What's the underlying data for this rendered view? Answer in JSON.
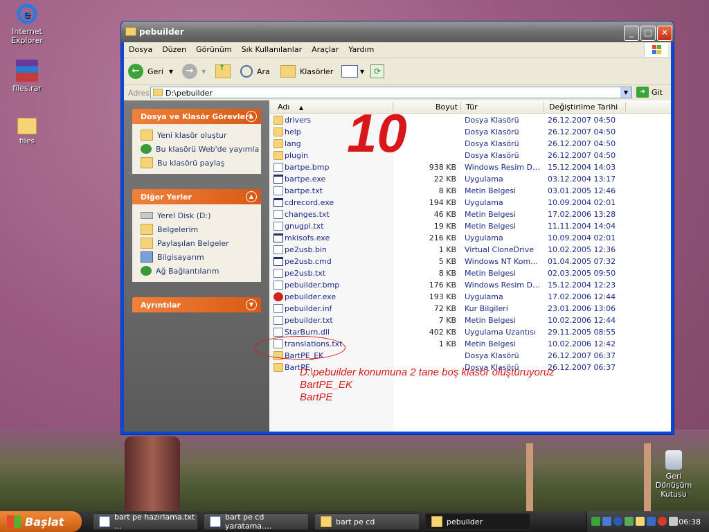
{
  "desktop": {
    "icons": [
      {
        "label": "Internet Explorer"
      },
      {
        "label": "files.rar"
      },
      {
        "label": "files"
      },
      {
        "label": "Geri Dönüşüm Kutusu"
      }
    ]
  },
  "window": {
    "title": "pebuilder",
    "menu": [
      "Dosya",
      "Düzen",
      "Görünüm",
      "Sık Kullanılanlar",
      "Araçlar",
      "Yardım"
    ],
    "toolbar": {
      "back": "Geri",
      "search": "Ara",
      "folders": "Klasörler"
    },
    "address": {
      "label": "Adres",
      "value": "D:\\pebuilder",
      "go": "Git"
    },
    "tasks_panel": {
      "title": "Dosya ve Klasör Görevleri",
      "items": [
        "Yeni klasör oluştur",
        "Bu klasörü Web'de yayımla",
        "Bu klasörü paylaş"
      ]
    },
    "places_panel": {
      "title": "Diğer Yerler",
      "items": [
        "Yerel Disk (D:)",
        "Belgelerim",
        "Paylaşılan Belgeler",
        "Bilgisayarım",
        "Ağ Bağlantılarım"
      ]
    },
    "details_panel": {
      "title": "Ayrıntılar"
    },
    "columns": {
      "name": "Adı",
      "size": "Boyut",
      "type": "Tür",
      "modified": "Değiştirilme Tarihi"
    },
    "files": [
      {
        "name": "drivers",
        "size": "",
        "type": "Dosya Klasörü",
        "date": "26.12.2007 04:50",
        "icon": "folder"
      },
      {
        "name": "help",
        "size": "",
        "type": "Dosya Klasörü",
        "date": "26.12.2007 04:50",
        "icon": "folder"
      },
      {
        "name": "lang",
        "size": "",
        "type": "Dosya Klasörü",
        "date": "26.12.2007 04:50",
        "icon": "folder"
      },
      {
        "name": "plugin",
        "size": "",
        "type": "Dosya Klasörü",
        "date": "26.12.2007 04:50",
        "icon": "folder"
      },
      {
        "name": "bartpe.bmp",
        "size": "938 KB",
        "type": "Windows Resim Dos...",
        "date": "15.12.2004 14:03",
        "icon": "file"
      },
      {
        "name": "bartpe.exe",
        "size": "22 KB",
        "type": "Uygulama",
        "date": "03.12.2004 13:17",
        "icon": "exe"
      },
      {
        "name": "bartpe.txt",
        "size": "8 KB",
        "type": "Metin Belgesi",
        "date": "03.01.2005 12:46",
        "icon": "file"
      },
      {
        "name": "cdrecord.exe",
        "size": "194 KB",
        "type": "Uygulama",
        "date": "10.09.2004 02:01",
        "icon": "exe"
      },
      {
        "name": "changes.txt",
        "size": "46 KB",
        "type": "Metin Belgesi",
        "date": "17.02.2006 13:28",
        "icon": "file"
      },
      {
        "name": "gnugpl.txt",
        "size": "19 KB",
        "type": "Metin Belgesi",
        "date": "11.11.2004 14:04",
        "icon": "file"
      },
      {
        "name": "mkisofs.exe",
        "size": "216 KB",
        "type": "Uygulama",
        "date": "10.09.2004 02:01",
        "icon": "exe"
      },
      {
        "name": "pe2usb.bin",
        "size": "1 KB",
        "type": "Virtual CloneDrive",
        "date": "10.02.2005 12:36",
        "icon": "file"
      },
      {
        "name": "pe2usb.cmd",
        "size": "5 KB",
        "type": "Windows NT Komut ...",
        "date": "01.04.2005 07:32",
        "icon": "exe"
      },
      {
        "name": "pe2usb.txt",
        "size": "8 KB",
        "type": "Metin Belgesi",
        "date": "02.03.2005 09:50",
        "icon": "file"
      },
      {
        "name": "pebuilder.bmp",
        "size": "176 KB",
        "type": "Windows Resim Dos...",
        "date": "15.12.2004 12:23",
        "icon": "file"
      },
      {
        "name": "pebuilder.exe",
        "size": "193 KB",
        "type": "Uygulama",
        "date": "17.02.2006 12:44",
        "icon": "pe"
      },
      {
        "name": "pebuilder.inf",
        "size": "72 KB",
        "type": "Kur Bilgileri",
        "date": "23.01.2006 13:06",
        "icon": "file"
      },
      {
        "name": "pebuilder.txt",
        "size": "7 KB",
        "type": "Metin Belgesi",
        "date": "10.02.2006 12:44",
        "icon": "file"
      },
      {
        "name": "StarBurn.dll",
        "size": "402 KB",
        "type": "Uygulama Uzantısı",
        "date": "29.11.2005 08:55",
        "icon": "file"
      },
      {
        "name": "translations.txt",
        "size": "1 KB",
        "type": "Metin Belgesi",
        "date": "10.02.2006 12:42",
        "icon": "file"
      },
      {
        "name": "BartPE_EK",
        "size": "",
        "type": "Dosya Klasörü",
        "date": "26.12.2007 06:37",
        "icon": "folder"
      },
      {
        "name": "BartPE",
        "size": "",
        "type": "Dosya Klasörü",
        "date": "26.12.2007 06:37",
        "icon": "folder"
      }
    ],
    "annotation": {
      "step": "10",
      "lines": [
        "D:\\pebuilder konumuna 2 tane boş klasör oluşturuyoruz",
        "BartPE_EK",
        "BartPE"
      ],
      "color": "#d81818"
    }
  },
  "taskbar": {
    "start": "Başlat",
    "buttons": [
      "bart pe hazırlama.txt ...",
      "bart pe cd yaratama....",
      "bart pe cd",
      "pebuilder"
    ],
    "clock": "06:38"
  }
}
